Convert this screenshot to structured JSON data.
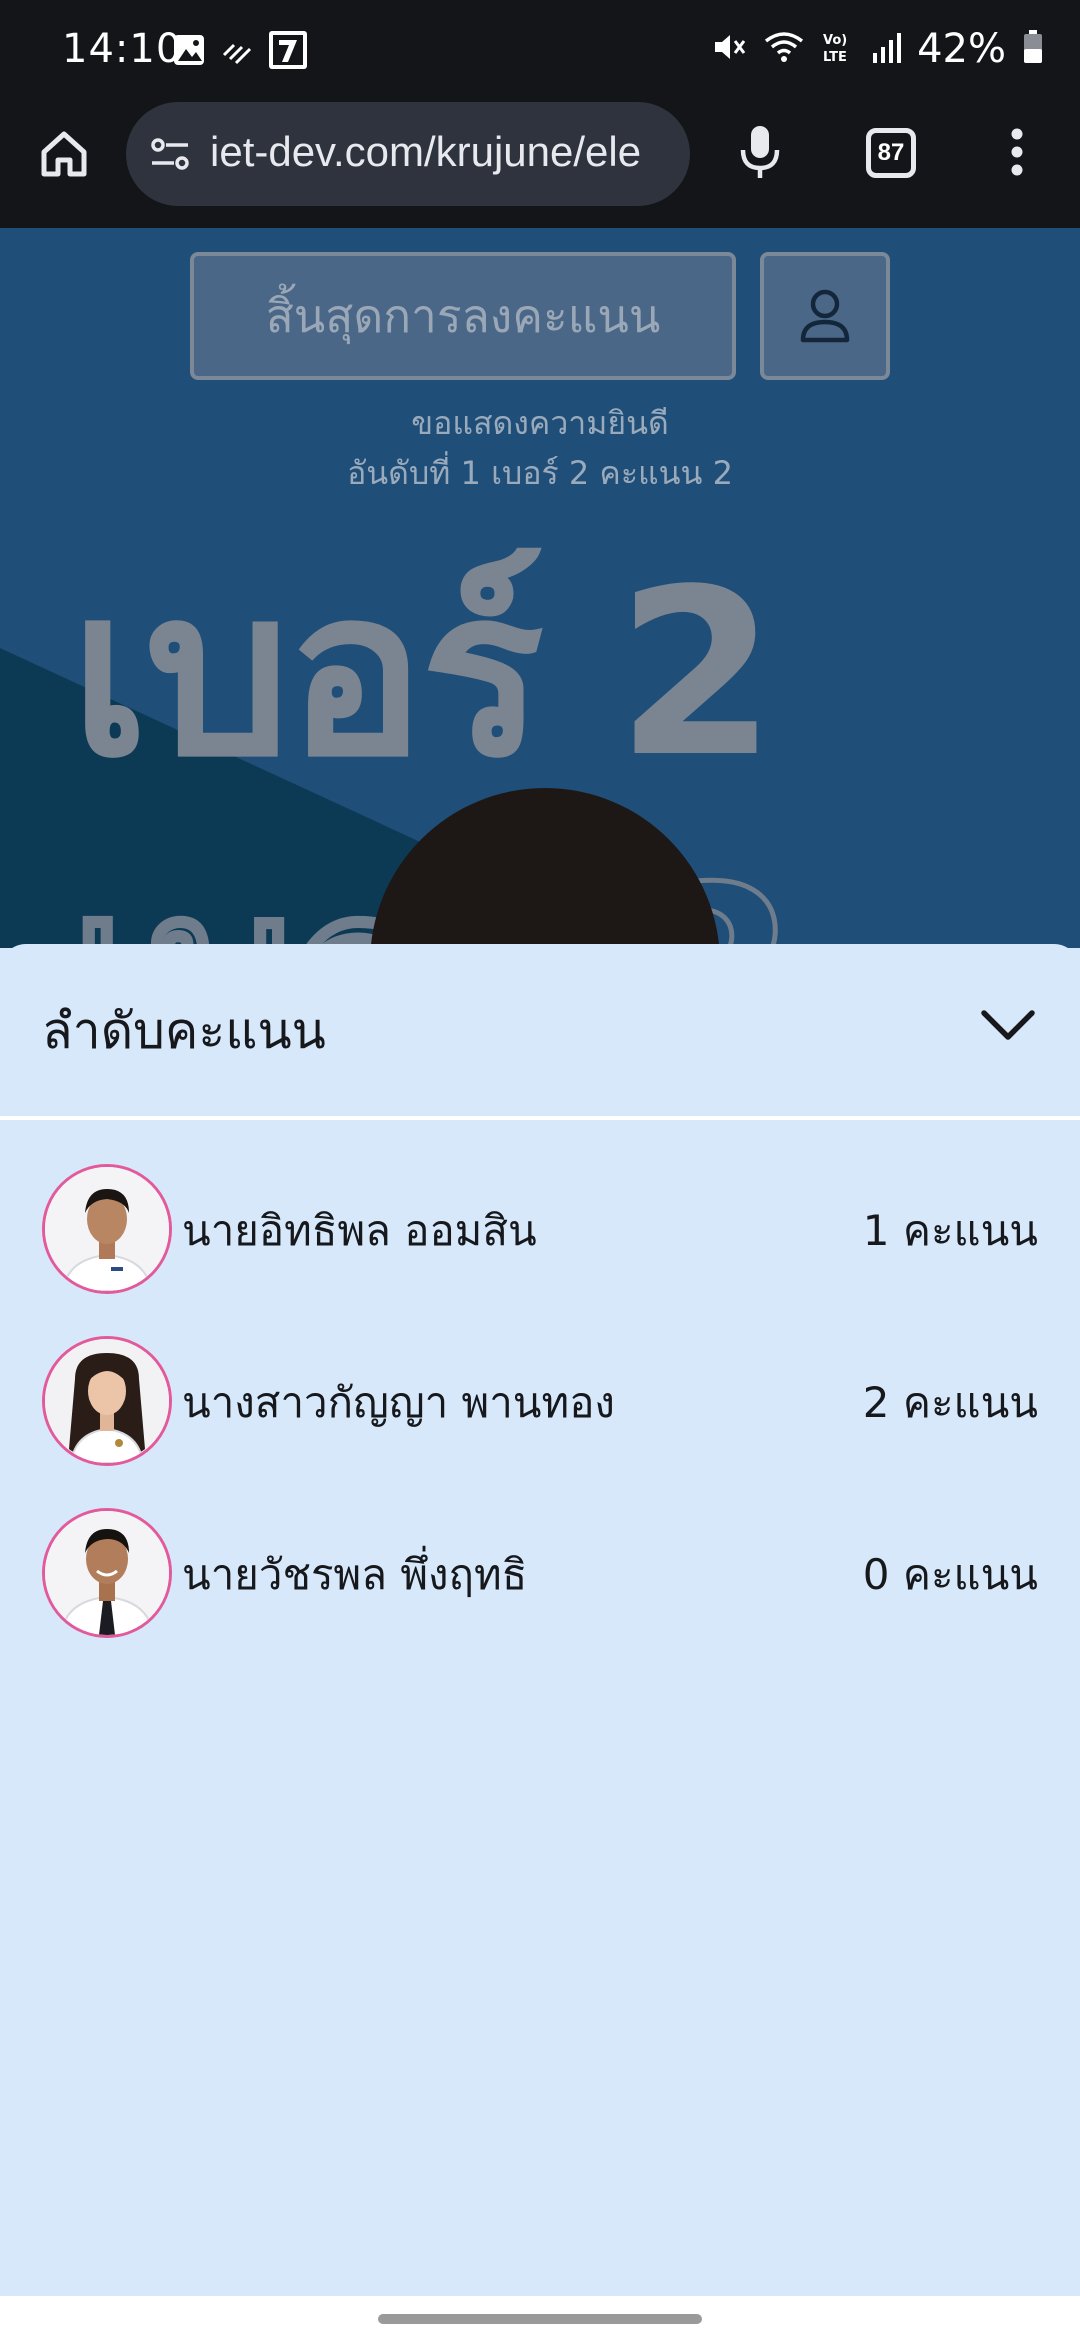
{
  "status_bar": {
    "time": "14:10",
    "battery_text": "42%",
    "left_icons": [
      "image-icon",
      "data-sync-icon",
      "seven-eleven-app-icon"
    ],
    "right_icons": [
      "mute-icon",
      "wifi-icon",
      "volte-icon",
      "signal-icon",
      "battery-icon"
    ]
  },
  "browser": {
    "url": "iet-dev.com/krujune/ele",
    "tab_count": "87"
  },
  "page": {
    "end_vote_label": "สิ้นสุดการลงคะแนน",
    "congrats_line1": "ขอแสดงความยินดี",
    "congrats_line2": "อันดับที่ 1 เบอร์ 2 คะแนน 2",
    "big_number": "เบอร์ 2"
  },
  "sheet": {
    "title": "ลำดับคะแนน",
    "candidates": [
      {
        "name": "นายอิทธิพล ออมสิน",
        "score": "1 คะแนน"
      },
      {
        "name": "นางสาวกัญญา พานทอง",
        "score": "2 คะแนน"
      },
      {
        "name": "นายวัชรพล พึ่งฤทธิ",
        "score": "0 คะแนน"
      }
    ]
  },
  "colors": {
    "page_background": "#1f4f79",
    "sheet_background": "#d7e8fb",
    "avatar_border": "#e35a9b"
  }
}
